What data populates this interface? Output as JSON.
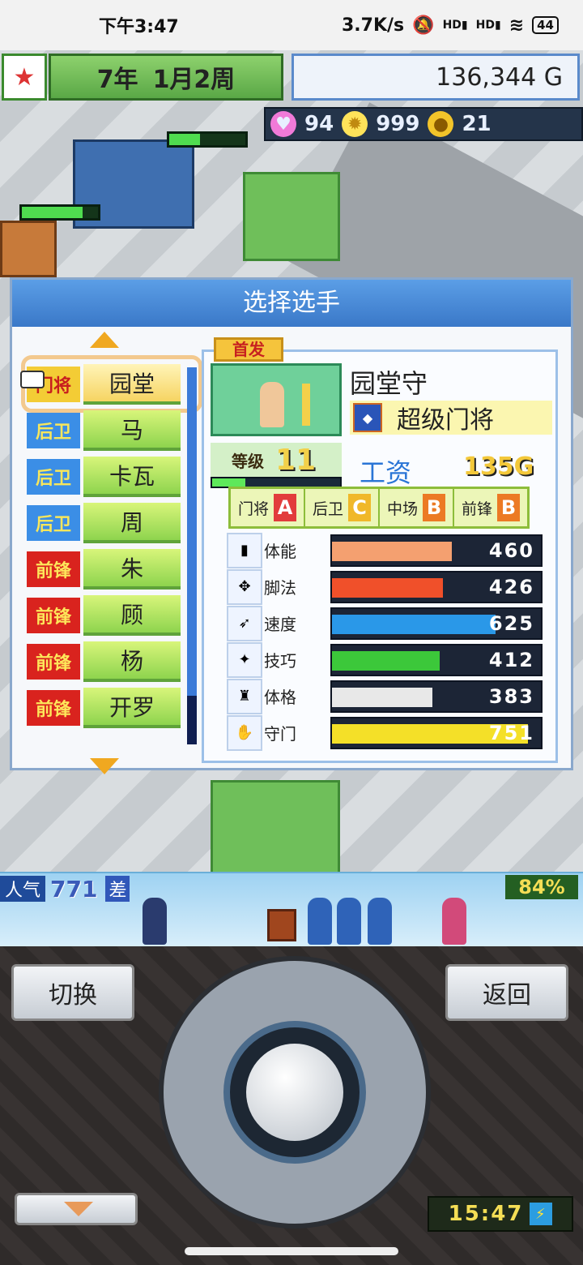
{
  "status_bar": {
    "time": "下午3:47",
    "network_speed": "3.7K/s",
    "signal1": "HD",
    "signal2": "HD",
    "battery": "44"
  },
  "header": {
    "year": "7年",
    "week": "1月2周",
    "money": "136,344 G"
  },
  "resources": {
    "hearts": "94",
    "ideas": "999",
    "medals": "21"
  },
  "panel": {
    "title": "选择选手"
  },
  "players": [
    {
      "pos": "门将",
      "name": "园堂",
      "type": "gk",
      "selected": true
    },
    {
      "pos": "后卫",
      "name": "马",
      "type": "df"
    },
    {
      "pos": "后卫",
      "name": "卡瓦",
      "type": "df"
    },
    {
      "pos": "后卫",
      "name": "周",
      "type": "df"
    },
    {
      "pos": "前锋",
      "name": "朱",
      "type": "fw"
    },
    {
      "pos": "前锋",
      "name": "顾",
      "type": "fw"
    },
    {
      "pos": "前锋",
      "name": "杨",
      "type": "fw"
    },
    {
      "pos": "前锋",
      "name": "开罗",
      "type": "fw"
    }
  ],
  "detail": {
    "badge": "首发",
    "name": "园堂守",
    "skill_icon": "shield-skill-icon",
    "title": "超级门将",
    "level_label": "等级",
    "level": "11",
    "salary_label": "工资",
    "salary": "135G",
    "aptitudes": [
      {
        "label": "门将",
        "grade": "A"
      },
      {
        "label": "后卫",
        "grade": "C"
      },
      {
        "label": "中场",
        "grade": "B"
      },
      {
        "label": "前锋",
        "grade": "B"
      }
    ],
    "attributes": [
      {
        "label": "体能",
        "value": 460,
        "color": "#f4a070",
        "icon": "stamina-icon"
      },
      {
        "label": "脚法",
        "value": 426,
        "color": "#f0502a",
        "icon": "kick-icon"
      },
      {
        "label": "速度",
        "value": 625,
        "color": "#2a98e8",
        "icon": "speed-icon"
      },
      {
        "label": "技巧",
        "value": 412,
        "color": "#3cc83a",
        "icon": "technique-icon"
      },
      {
        "label": "体格",
        "value": 383,
        "color": "#e8e8e8",
        "icon": "physique-icon"
      },
      {
        "label": "守门",
        "value": 751,
        "color": "#f4e028",
        "icon": "goalkeeping-icon"
      }
    ],
    "attr_max": 800
  },
  "crowd": {
    "popularity_label": "人气",
    "popularity": "771",
    "rank": "差",
    "percent": "84%"
  },
  "controls": {
    "switch_label": "切换",
    "back_label": "返回",
    "clock": "15:47"
  }
}
